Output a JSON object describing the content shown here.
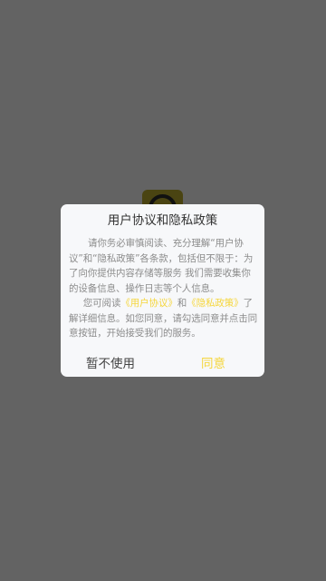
{
  "dialog": {
    "title": "用户协议和隐私政策",
    "paragraph1": "请你务必审慎阅读、充分理解“用户协议”和“隐私政策”各条款，包括但不限于：为了向你提供内容存储等服务 我们需要收集你的设备信息、操作日志等个人信息。",
    "paragraph2_prefix": "您可阅读",
    "user_agreement_link": "《用户协议》",
    "paragraph2_and": "和",
    "privacy_policy_link": "《隐私政策》",
    "paragraph2_suffix": "了解详细信息。如您同意，请勾选同意并点击同意按钮，开始接受我们的服务。",
    "decline_label": "暂不使用",
    "agree_label": "同意"
  },
  "colors": {
    "overlay": "#636363",
    "dialog_bg": "#f7f8fa",
    "accent": "#f5d63c",
    "body_text": "#8c8c8c",
    "title_text": "#333333"
  }
}
